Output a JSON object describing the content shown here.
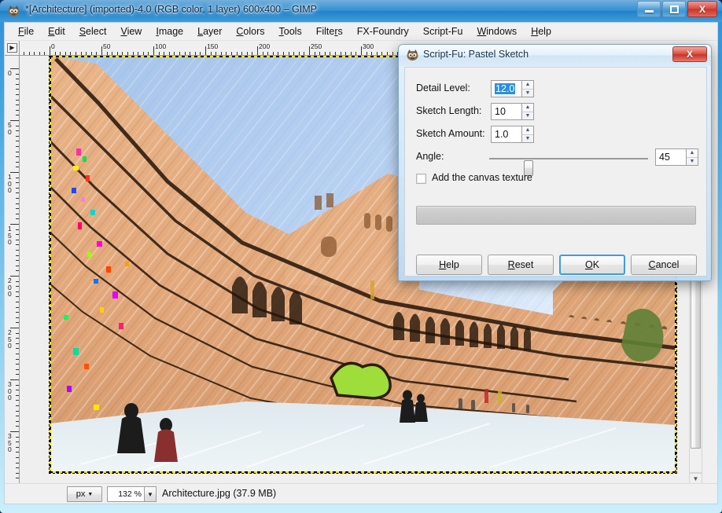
{
  "window": {
    "title": "*[Architecture] (imported)-4.0 (RGB color, 1 layer) 600x400 – GIMP",
    "minimize_label": "Minimize",
    "maximize_label": "Maximize",
    "close_label": "X"
  },
  "menubar": {
    "items": [
      {
        "label": "File",
        "mnemonic": "F"
      },
      {
        "label": "Edit",
        "mnemonic": "E"
      },
      {
        "label": "Select",
        "mnemonic": "S"
      },
      {
        "label": "View",
        "mnemonic": "V"
      },
      {
        "label": "Image",
        "mnemonic": "I"
      },
      {
        "label": "Layer",
        "mnemonic": "L"
      },
      {
        "label": "Colors",
        "mnemonic": "C"
      },
      {
        "label": "Tools",
        "mnemonic": "T"
      },
      {
        "label": "Filters",
        "mnemonic": "r"
      },
      {
        "label": "FX-Foundry",
        "mnemonic": ""
      },
      {
        "label": "Script-Fu",
        "mnemonic": ""
      },
      {
        "label": "Windows",
        "mnemonic": "W"
      },
      {
        "label": "Help",
        "mnemonic": "H"
      }
    ]
  },
  "rulers": {
    "horizontal_labels": [
      "0",
      "50",
      "100",
      "150",
      "200",
      "250",
      "300"
    ],
    "vertical_labels": [
      "0",
      "50",
      "100",
      "150",
      "200",
      "250",
      "300",
      "350"
    ],
    "unit": "px"
  },
  "statusbar": {
    "unit": "px",
    "zoom": "132 %",
    "filename_info": "Architecture.jpg (37.9 MB)"
  },
  "dialog": {
    "title": "Script-Fu: Pastel Sketch",
    "close_label": "X",
    "fields": [
      {
        "label": "Detail Level:",
        "value": "12.0",
        "selected": true
      },
      {
        "label": "Sketch Length:",
        "value": "10",
        "selected": false
      },
      {
        "label": "Sketch Amount:",
        "value": "1.0",
        "selected": false
      }
    ],
    "angle": {
      "label": "Angle:",
      "value": "45",
      "slider_percent": 23
    },
    "checkbox": {
      "label": "Add the canvas texture",
      "checked": false
    },
    "progress": {
      "value": "",
      "percent": 0
    },
    "buttons": [
      {
        "name": "help",
        "label": "Help",
        "mnemonic": "H",
        "focused": false
      },
      {
        "name": "reset",
        "label": "Reset",
        "mnemonic": "R",
        "focused": false
      },
      {
        "name": "ok",
        "label": "OK",
        "mnemonic": "O",
        "focused": true
      },
      {
        "name": "cancel",
        "label": "Cancel",
        "mnemonic": "C",
        "focused": false
      }
    ]
  },
  "icons": {
    "title_icon": "gimp-wilber-icon",
    "dialog_icon": "gimp-wilber-icon",
    "quickmask": "quickmask-toggle-icon",
    "navigator": "navigate-move-icon"
  }
}
